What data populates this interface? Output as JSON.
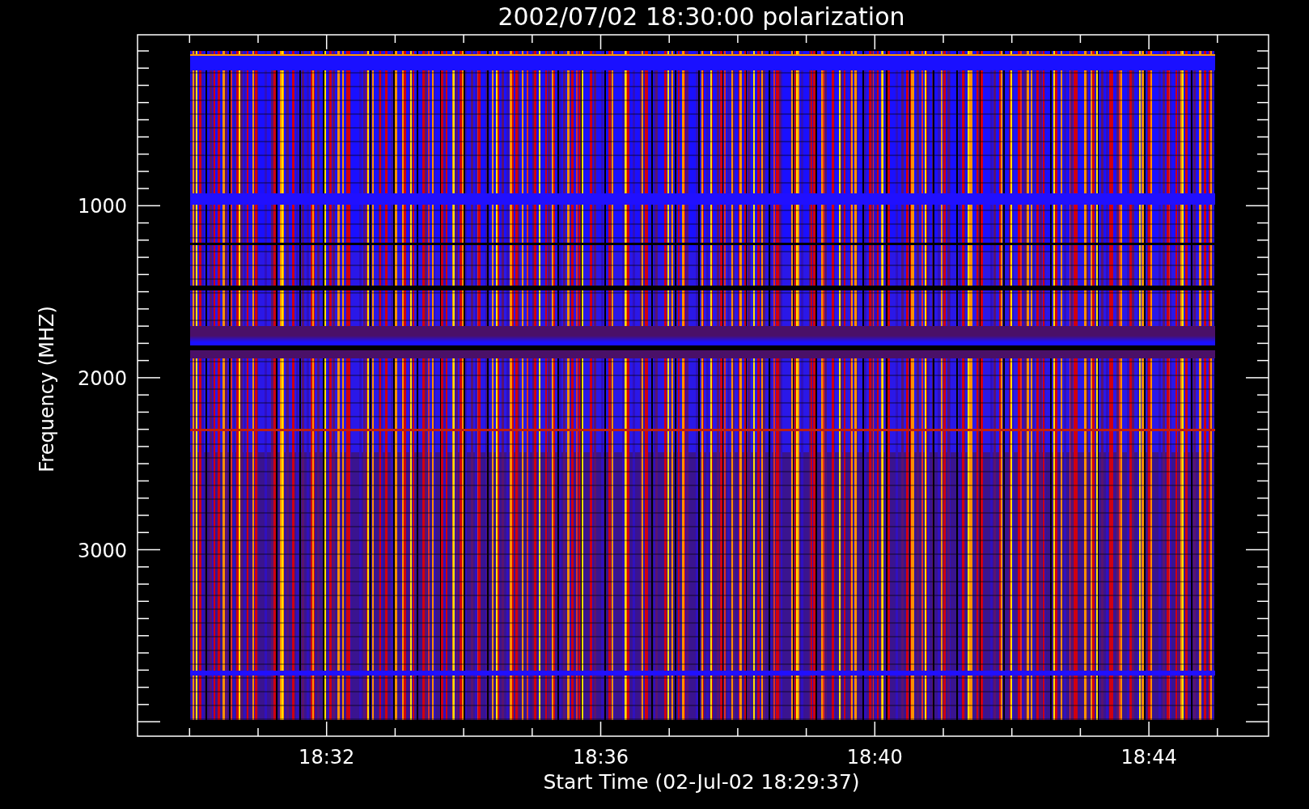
{
  "title": "2002/07/02 18:30:00 polarization",
  "y_axis": {
    "label": "Frequency (MHZ)",
    "ticks": [
      "1000",
      "2000",
      "3000"
    ]
  },
  "x_axis": {
    "label": "Start Time (02-Jul-02 18:29:37)",
    "ticks": [
      "18:32",
      "18:36",
      "18:40",
      "18:44"
    ]
  }
}
